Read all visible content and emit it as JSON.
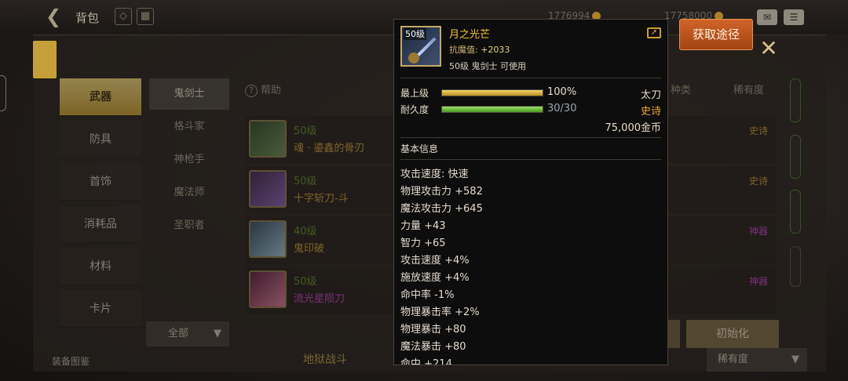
{
  "topbar": {
    "title": "背包",
    "currency1": "1776994",
    "currency2": "17758000"
  },
  "categories": [
    {
      "label": "武器",
      "active": true
    },
    {
      "label": "防具"
    },
    {
      "label": "首饰"
    },
    {
      "label": "消耗品"
    },
    {
      "label": "材料"
    },
    {
      "label": "卡片"
    }
  ],
  "classes": [
    {
      "label": "鬼剑士",
      "active": true
    },
    {
      "label": "格斗家"
    },
    {
      "label": "神枪手"
    },
    {
      "label": "魔法师"
    },
    {
      "label": "圣职者"
    }
  ],
  "help_label": "帮助",
  "column_headers": {
    "type": "种类",
    "rarity": "稀有度"
  },
  "items": [
    {
      "level": "50级",
      "name": "魂 · 鎏鑫的骨刃",
      "rarity": "史诗",
      "name_color": "#c89a33",
      "rarity_color": "#c89a33"
    },
    {
      "level": "50级",
      "name": "十字斩刀-斗",
      "rarity": "史诗",
      "name_color": "#c89a33",
      "rarity_color": "#c89a33"
    },
    {
      "level": "40级",
      "name": "鬼印破",
      "rarity": "神器",
      "name_color": "#c89a33",
      "rarity_color": "#c43fc6"
    },
    {
      "level": "50级",
      "name": "流光星陨刀",
      "rarity": "神器",
      "name_color": "#c43fc6",
      "rarity_color": "#c43fc6"
    }
  ],
  "filter_label": "全部",
  "reset_label": "初始化",
  "sort_label": "稀有度",
  "bottom_left": "装备图鉴",
  "bottom_mid": "地狱战斗",
  "acquire_label": "获取途径",
  "tooltip": {
    "icon_level": "50级",
    "name": "月之光芒",
    "magic_resist_label": "抗魔值:",
    "magic_resist_value": "+2033",
    "usable": "50级 鬼剑士 可使用",
    "upgrade_label": "最上级",
    "upgrade_pct": "100%",
    "upgrade_fraction": 1.0,
    "durability_label": "耐久度",
    "durability_value": "30/30",
    "durability_fraction": 1.0,
    "weapon_type": "太刀",
    "rarity": "史诗",
    "price": "75,000金币",
    "basic_info": "基本信息",
    "stats": [
      "攻击速度: 快速",
      "物理攻击力 +582",
      "魔法攻击力 +645",
      "力量 +43",
      "智力 +65",
      "攻击速度 +4%",
      "施放速度 +4%",
      "命中率 -1%",
      "物理暴击率 +2%",
      "物理暴击 +80",
      "魔法暴击 +80",
      "命中 +214"
    ]
  },
  "colors": {
    "accent_gold": "#c99e31",
    "acquire_orange": "#b8501a",
    "rare_purple": "#c43fc6",
    "green_level": "#5d8a27"
  }
}
